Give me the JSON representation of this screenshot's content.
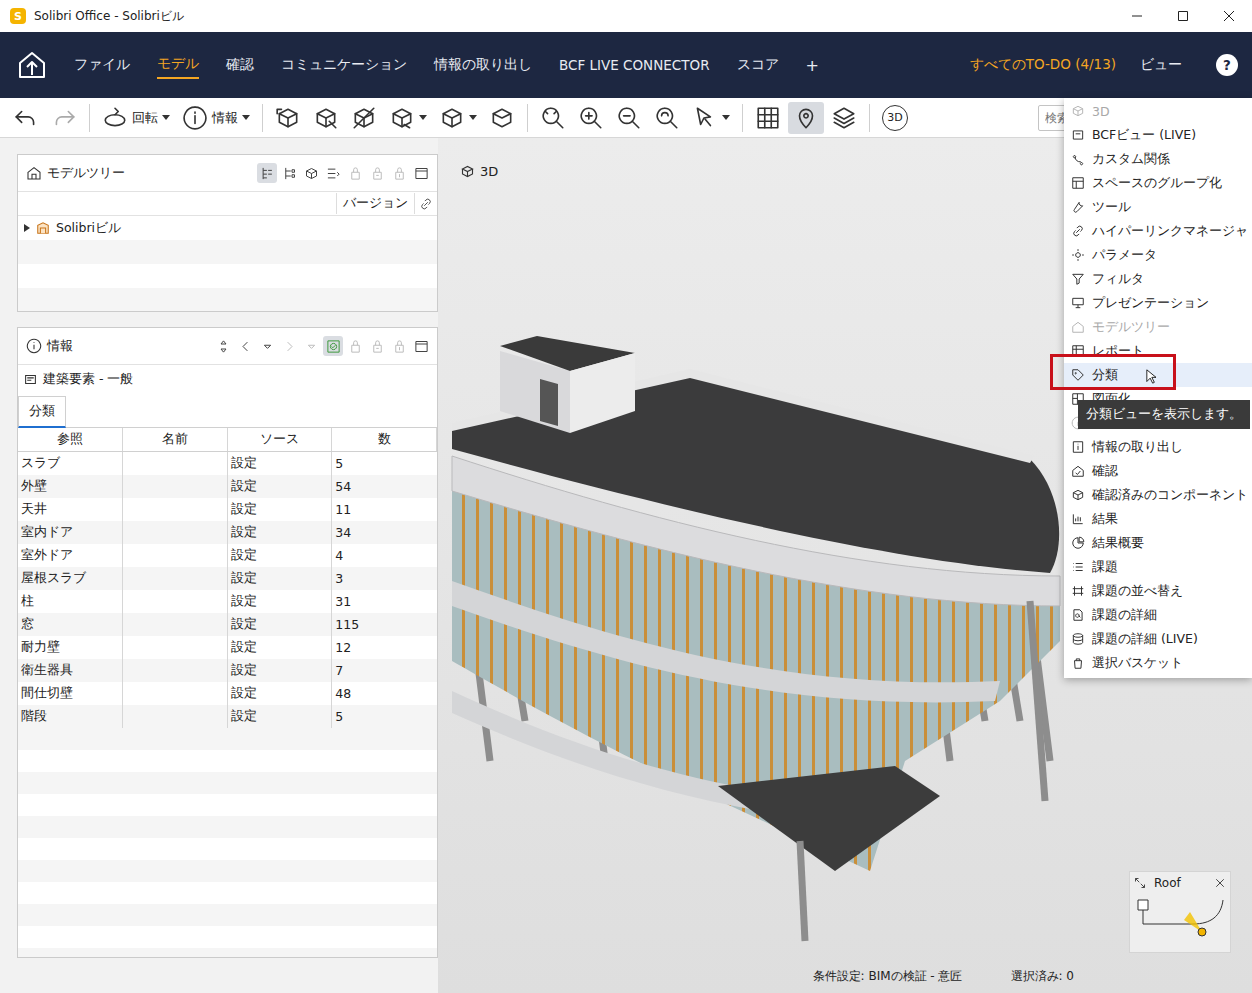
{
  "window": {
    "title": "Solibri Office - Solibriビル",
    "logo": "S"
  },
  "nav": {
    "tabs": [
      {
        "label": "ファイル",
        "selected": false
      },
      {
        "label": "モデル",
        "selected": true
      },
      {
        "label": "確認",
        "selected": false
      },
      {
        "label": "コミュニケーション",
        "selected": false
      },
      {
        "label": "情報の取り出し",
        "selected": false
      },
      {
        "label": "BCF LIVE CONNECTOR",
        "selected": false
      },
      {
        "label": "スコア",
        "selected": false
      }
    ],
    "add": "+",
    "todo": "すべてのTO-DO (4/13)",
    "view": "ビュー",
    "help": "?"
  },
  "toolbar": {
    "items": [
      {
        "kind": "button",
        "label": "",
        "dropdown": false,
        "selected": false,
        "disabled": false
      },
      {
        "kind": "button",
        "label": "",
        "dropdown": false,
        "selected": false,
        "disabled": true
      },
      {
        "kind": "separator"
      },
      {
        "kind": "button",
        "label": "回転",
        "dropdown": true,
        "selected": false,
        "disabled": false
      },
      {
        "kind": "button",
        "label": "情報",
        "dropdown": true,
        "selected": false,
        "disabled": false
      },
      {
        "kind": "separator"
      },
      {
        "kind": "button",
        "label": "",
        "dropdown": false,
        "selected": false,
        "disabled": false
      },
      {
        "kind": "button",
        "label": "",
        "dropdown": false,
        "selected": false,
        "disabled": false
      },
      {
        "kind": "button",
        "label": "",
        "dropdown": false,
        "selected": false,
        "disabled": false
      },
      {
        "kind": "button",
        "label": "",
        "dropdown": true,
        "selected": false,
        "disabled": false
      },
      {
        "kind": "button",
        "label": "",
        "dropdown": true,
        "selected": false,
        "disabled": false
      },
      {
        "kind": "button",
        "label": "",
        "dropdown": false,
        "selected": false,
        "disabled": false
      },
      {
        "kind": "separator"
      },
      {
        "kind": "button",
        "label": "",
        "dropdown": false,
        "selected": false,
        "disabled": false
      },
      {
        "kind": "button",
        "label": "",
        "dropdown": false,
        "selected": false,
        "disabled": false
      },
      {
        "kind": "button",
        "label": "",
        "dropdown": false,
        "selected": false,
        "disabled": false
      },
      {
        "kind": "button",
        "label": "",
        "dropdown": false,
        "selected": false,
        "disabled": false
      },
      {
        "kind": "button",
        "label": "",
        "dropdown": true,
        "selected": false,
        "disabled": false
      },
      {
        "kind": "separator"
      },
      {
        "kind": "button",
        "label": "",
        "dropdown": false,
        "selected": false,
        "disabled": false
      },
      {
        "kind": "button",
        "label": "",
        "dropdown": false,
        "selected": true,
        "disabled": false
      },
      {
        "kind": "button",
        "label": "",
        "dropdown": false,
        "selected": false,
        "disabled": false
      },
      {
        "kind": "separator"
      },
      {
        "kind": "text-icon",
        "label": "3D",
        "dropdown": false,
        "selected": false,
        "disabled": false
      }
    ],
    "search": {
      "placeholder": "検索"
    }
  },
  "model_tree": {
    "title": "モデルツリー",
    "tools": [
      {
        "selected": true,
        "disabled": false
      },
      {
        "selected": false,
        "disabled": false
      },
      {
        "selected": false,
        "disabled": false
      },
      {
        "selected": false,
        "disabled": false
      },
      {
        "selected": false,
        "disabled": true
      },
      {
        "selected": false,
        "disabled": true
      },
      {
        "selected": false,
        "disabled": true
      },
      {
        "selected": false,
        "disabled": false
      }
    ],
    "column": "バージョン",
    "items": [
      {
        "label": "Solibriビル",
        "expanded": false
      }
    ]
  },
  "info": {
    "title": "情報",
    "tools": [
      {
        "selected": false,
        "disabled": false
      },
      {
        "selected": false,
        "disabled": false
      },
      {
        "selected": false,
        "disabled": false
      },
      {
        "selected": false,
        "disabled": true
      },
      {
        "selected": false,
        "disabled": true
      },
      {
        "selected": true,
        "disabled": false
      },
      {
        "selected": false,
        "disabled": true
      },
      {
        "selected": false,
        "disabled": true
      },
      {
        "selected": false,
        "disabled": true
      },
      {
        "selected": false,
        "disabled": false
      }
    ],
    "subtitle": "建築要素 - 一般",
    "tabs": [
      {
        "label": "分類",
        "selected": true
      }
    ],
    "columns": [
      "参照",
      "名前",
      "ソース",
      "数"
    ],
    "rows": [
      {
        "ref": "スラブ",
        "name": "",
        "source": "設定",
        "count": "5"
      },
      {
        "ref": "外壁",
        "name": "",
        "source": "設定",
        "count": "54"
      },
      {
        "ref": "天井",
        "name": "",
        "source": "設定",
        "count": "11"
      },
      {
        "ref": "室内ドア",
        "name": "",
        "source": "設定",
        "count": "34"
      },
      {
        "ref": "室外ドア",
        "name": "",
        "source": "設定",
        "count": "4"
      },
      {
        "ref": "屋根スラブ",
        "name": "",
        "source": "設定",
        "count": "3"
      },
      {
        "ref": "柱",
        "name": "",
        "source": "設定",
        "count": "31"
      },
      {
        "ref": "窓",
        "name": "",
        "source": "設定",
        "count": "115"
      },
      {
        "ref": "耐力壁",
        "name": "",
        "source": "設定",
        "count": "12"
      },
      {
        "ref": "衛生器具",
        "name": "",
        "source": "設定",
        "count": "7"
      },
      {
        "ref": "間仕切壁",
        "name": "",
        "source": "設定",
        "count": "48"
      },
      {
        "ref": "階段",
        "name": "",
        "source": "設定",
        "count": "5"
      }
    ]
  },
  "view": {
    "title": "3D",
    "minimap": {
      "title": "Roof"
    }
  },
  "status_bar": {
    "rule": "条件設定: BIMの検証 - 意匠",
    "selected": "選択済み: 0"
  },
  "menu": {
    "items": [
      {
        "label": "3D",
        "disabled": true,
        "highlighted": false,
        "marked": false
      },
      {
        "label": "BCFビュー (LIVE)",
        "disabled": false,
        "highlighted": false,
        "marked": false
      },
      {
        "label": "カスタム関係",
        "disabled": false,
        "highlighted": false,
        "marked": false
      },
      {
        "label": "スペースのグループ化",
        "disabled": false,
        "highlighted": false,
        "marked": false
      },
      {
        "label": "ツール",
        "disabled": false,
        "highlighted": false,
        "marked": false
      },
      {
        "label": "ハイパーリンクマネージャ",
        "disabled": false,
        "highlighted": false,
        "marked": false
      },
      {
        "label": "パラメータ",
        "disabled": false,
        "highlighted": false,
        "marked": false
      },
      {
        "label": "フィルタ",
        "disabled": false,
        "highlighted": false,
        "marked": false
      },
      {
        "label": "プレゼンテーション",
        "disabled": false,
        "highlighted": false,
        "marked": false
      },
      {
        "label": "モデルツリー",
        "disabled": true,
        "highlighted": false,
        "marked": false
      },
      {
        "label": "レポート",
        "disabled": false,
        "highlighted": false,
        "marked": false
      },
      {
        "label": "分類",
        "disabled": false,
        "highlighted": true,
        "marked": true
      },
      {
        "label": "図面化",
        "disabled": false,
        "highlighted": false,
        "marked": false
      },
      {
        "label": "情報",
        "disabled": true,
        "highlighted": false,
        "marked": false
      },
      {
        "label": "情報の取り出し",
        "disabled": false,
        "highlighted": false,
        "marked": false
      },
      {
        "label": "確認",
        "disabled": false,
        "highlighted": false,
        "marked": false
      },
      {
        "label": "確認済みのコンポーネント",
        "disabled": false,
        "highlighted": false,
        "marked": false
      },
      {
        "label": "結果",
        "disabled": false,
        "highlighted": false,
        "marked": false
      },
      {
        "label": "結果概要",
        "disabled": false,
        "highlighted": false,
        "marked": false
      },
      {
        "label": "課題",
        "disabled": false,
        "highlighted": false,
        "marked": false
      },
      {
        "label": "課題の並べ替え",
        "disabled": false,
        "highlighted": false,
        "marked": false
      },
      {
        "label": "課題の詳細",
        "disabled": false,
        "highlighted": false,
        "marked": false
      },
      {
        "label": "課題の詳細 (LIVE)",
        "disabled": false,
        "highlighted": false,
        "marked": false
      },
      {
        "label": "選択バスケット",
        "disabled": false,
        "highlighted": false,
        "marked": false
      }
    ],
    "tooltip": "分類ビューを表示します。"
  }
}
